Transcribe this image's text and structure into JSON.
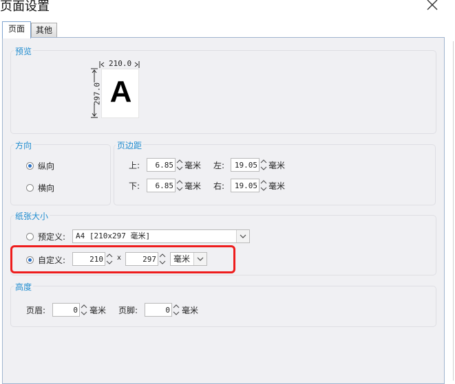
{
  "window": {
    "title": "页面设置"
  },
  "tabs": [
    {
      "label": "页面"
    },
    {
      "label": "其他"
    }
  ],
  "preview": {
    "legend": "预览",
    "width_label": "210.0",
    "height_label": "297.0",
    "paper_letter": "A"
  },
  "orientation": {
    "legend": "方向",
    "portrait_label": "纵向",
    "landscape_label": "横向",
    "selected": "portrait"
  },
  "margins": {
    "legend": "页边距",
    "top_label": "上:",
    "top_value": "6.85",
    "bottom_label": "下:",
    "bottom_value": "6.85",
    "left_label": "左:",
    "left_value": "19.05",
    "right_label": "右:",
    "right_value": "19.05",
    "unit": "毫米"
  },
  "paper_size": {
    "legend": "纸张大小",
    "predefined_label": "预定义:",
    "predefined_value": "A4 [210x297 毫米]",
    "custom_label": "自定义:",
    "custom_width": "210",
    "times": "x",
    "custom_height": "297",
    "custom_unit": "毫米",
    "selected": "custom"
  },
  "height": {
    "legend": "高度",
    "header_label": "页眉:",
    "header_value": "0",
    "footer_label": "页脚:",
    "footer_value": "0",
    "unit": "毫米"
  },
  "colors": {
    "accent": "#1f8ccf",
    "highlight": "#ee1c1c",
    "panel": "#f0f0f3"
  }
}
